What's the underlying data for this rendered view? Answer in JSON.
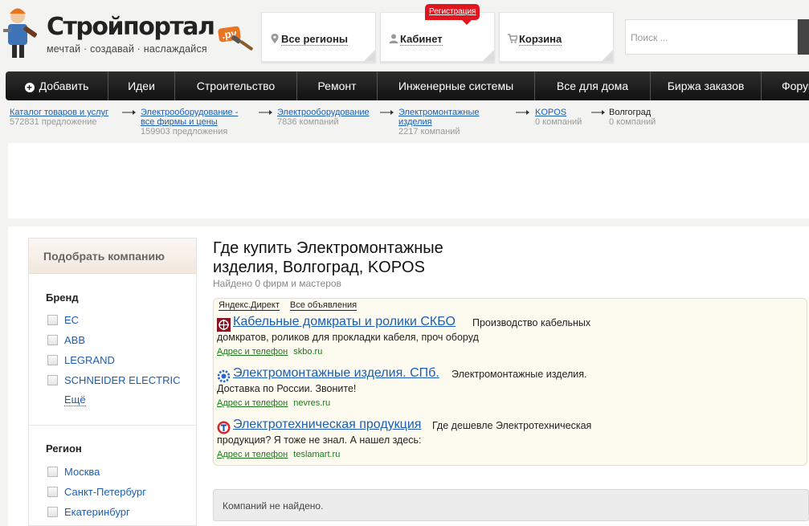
{
  "logo": {
    "title": "Стройпортал",
    "domain": ".ру",
    "tagline": "мечтай · создавай · наслаждайся"
  },
  "header": {
    "regions_label": "Все регионы",
    "cabinet_label": "Кабинет",
    "register_label": "Регистрация",
    "cart_label": "Корзина",
    "search_placeholder": "Поиск ..."
  },
  "nav": {
    "items": [
      "Добавить",
      "Идеи",
      "Строительство",
      "Ремонт",
      "Инженерные системы",
      "Все для дома",
      "Биржа заказов",
      "Форум"
    ]
  },
  "breadcrumb": [
    {
      "label": "Каталог товаров и услуг",
      "count": "572831 предложение"
    },
    {
      "label": "Электрооборудование - все фирмы и цены",
      "count": "159903 предложения"
    },
    {
      "label": "Электрооборудование",
      "count": "7836 компаний"
    },
    {
      "label": "Электромонтажные изделия",
      "count": "2217 компаний"
    },
    {
      "label": "KOPOS",
      "count": "0 компаний"
    },
    {
      "label": "Волгоград",
      "count": "0 компаний"
    }
  ],
  "sidebar": {
    "header": "Подобрать компанию",
    "brand_title": "Бренд",
    "brands": [
      "EC",
      "ABB",
      "LEGRAND",
      "SCHNEIDER ELECTRIC"
    ],
    "more": "Ещё",
    "region_title": "Регион",
    "regions": [
      "Москва",
      "Санкт-Петербург",
      "Екатеринбург"
    ]
  },
  "main": {
    "title": "Где купить Электромонтажные изделия, Волгоград, KOPOS",
    "found": "Найдено 0 фирм и мастеров",
    "not_found": "Компаний не найдено."
  },
  "ads": {
    "yandex_label": "Яндекс.Директ",
    "all_label": "Все объявления",
    "address_label": "Адрес и телефон",
    "items": [
      {
        "title": "Кабельные домкраты и ролики СКБО",
        "text": "Производство кабельных домкратов, роликов для прокладки кабеля, проч оборуд",
        "domain": "skbo.ru",
        "icon": "skbo-logo-icon"
      },
      {
        "title": "Электромонтажные изделия. СПб.",
        "text": "Электромонтажные изделия. Доставка по России. Звоните!",
        "domain": "nevres.ru",
        "icon": "nevres-gear-icon"
      },
      {
        "title": "Электротехническая продукция",
        "text": "Где дешевле Электротехническая продукция? Я тоже не знал. А нашел здесь:",
        "domain": "teslamart.ru",
        "icon": "teslamart-logo-icon"
      }
    ]
  },
  "colors": {
    "nav_bg": "#1e1e1e",
    "link": "#1a5fb4",
    "badge": "#e0171f",
    "logo_accent": "#e87522",
    "ad_bg": "#fdfaf0"
  }
}
